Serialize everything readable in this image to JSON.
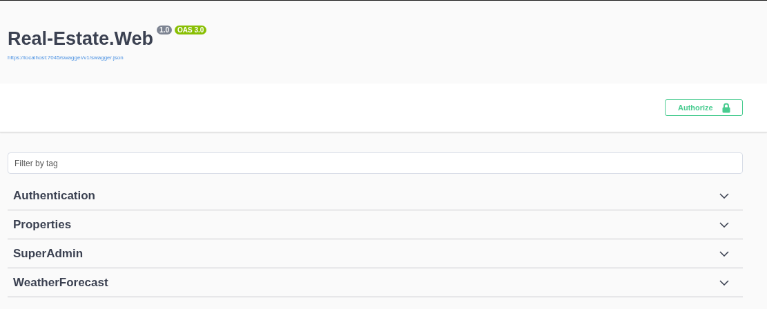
{
  "info": {
    "title": "Real-Estate.Web",
    "version": "1.0",
    "oas": "OAS 3.0",
    "url": "https://localhost:7045/swagger/v1/swagger.json"
  },
  "authorize": {
    "label": "Authorize"
  },
  "filter": {
    "placeholder": "Filter by tag"
  },
  "tags": [
    {
      "name": "Authentication",
      "expanded": false
    },
    {
      "name": "Properties",
      "expanded": false
    },
    {
      "name": "SuperAdmin",
      "expanded": false
    },
    {
      "name": "WeatherForecast",
      "expanded": false
    }
  ]
}
